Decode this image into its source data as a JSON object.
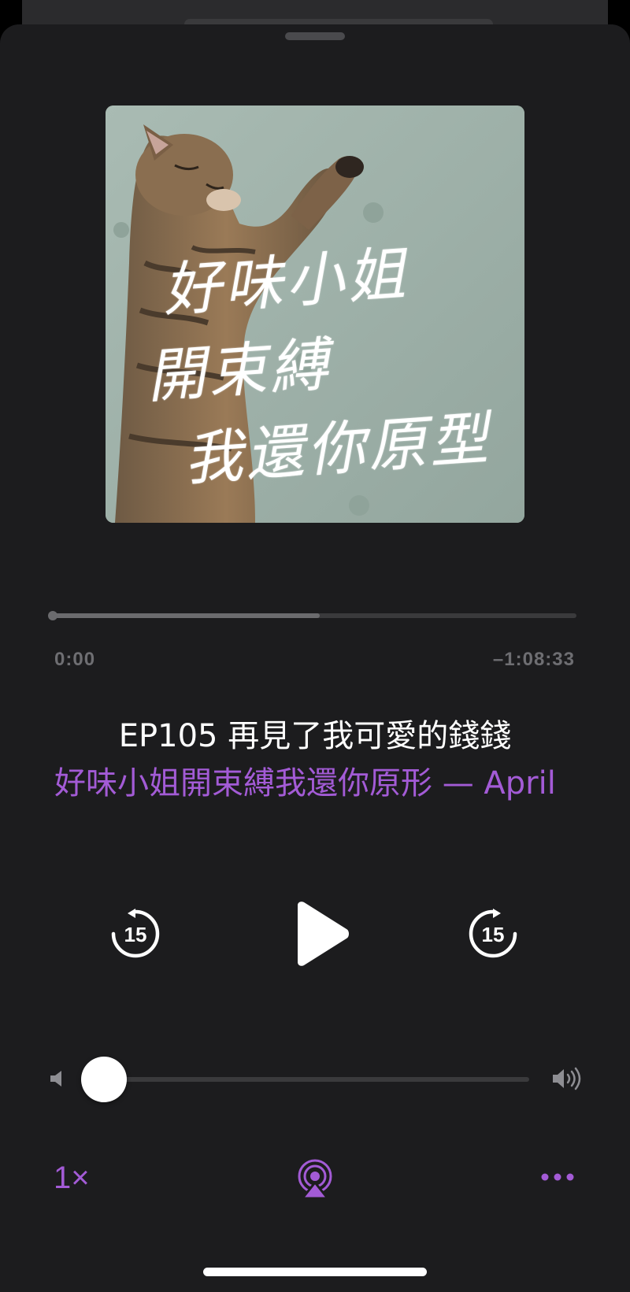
{
  "artwork": {
    "text_lines": [
      "好味小姐",
      "開束縛",
      "我還你原型"
    ]
  },
  "progress": {
    "elapsed": "0:00",
    "remaining": "–1:08:33",
    "played_fraction": 0.0,
    "buffered_fraction": 0.51
  },
  "episode": {
    "title": "EP105 再見了我可愛的錢錢",
    "show_line": "好味小姐開束縛我還你原形 — April"
  },
  "volume": {
    "level": 0.0
  },
  "controls": {
    "speed_label": "1×"
  },
  "icons": {
    "skip_back": "skip-back-15-icon",
    "play": "play-icon",
    "skip_forward": "skip-forward-15-icon",
    "volume_low": "speaker-low-icon",
    "volume_high": "speaker-high-icon",
    "airplay": "airplay-audio-icon",
    "more": "more-dots-icon"
  },
  "colors": {
    "accent": "#a35bd6",
    "sheet_background": "#1c1c1e",
    "text_primary": "#ffffff",
    "text_secondary": "#6e6e72"
  }
}
